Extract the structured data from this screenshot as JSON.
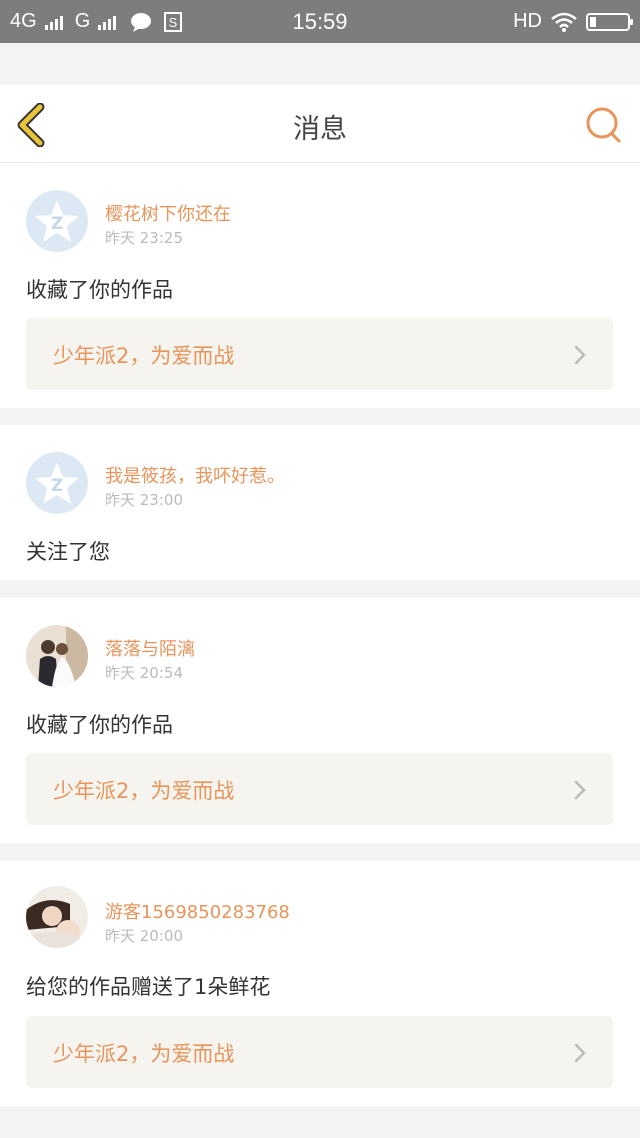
{
  "statusbar": {
    "net1": "4G",
    "net2": "G",
    "hd": "HD",
    "time": "15:59"
  },
  "header": {
    "title": "消息"
  },
  "icons": {
    "back": "chevron-left-icon",
    "search": "search-icon",
    "chevron": "chevron-right-icon"
  },
  "colors": {
    "accent": "#e8955c",
    "back_icon": "#e8c43a",
    "statusbar": "#7d7d7d"
  },
  "messages": [
    {
      "name": "樱花树下你还在",
      "time": "昨天 23:25",
      "action": "收藏了你的作品",
      "work": "少年派2，为爱而战"
    },
    {
      "name": "我是筱孩，我吥好惹。",
      "time": "昨天 23:00",
      "action": "关注了您"
    },
    {
      "name": "落落与陌漓",
      "time": "昨天 20:54",
      "action": "收藏了你的作品",
      "work": "少年派2，为爱而战"
    },
    {
      "name": "游客1569850283768",
      "time": "昨天 20:00",
      "action": "给您的作品赠送了1朵鲜花",
      "work": "少年派2，为爱而战"
    }
  ]
}
